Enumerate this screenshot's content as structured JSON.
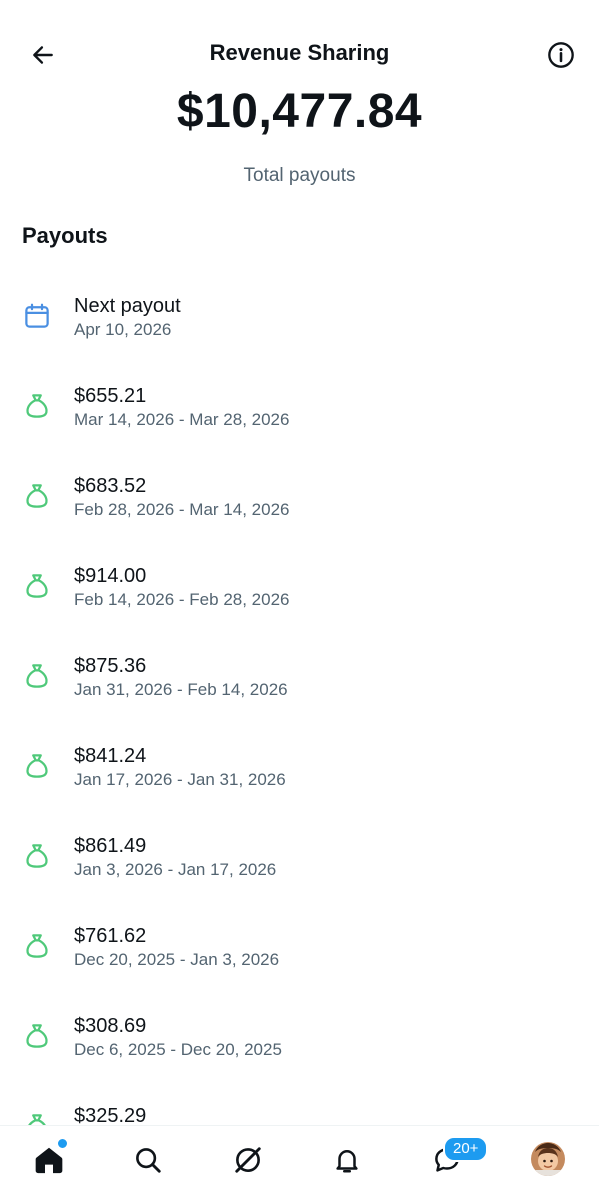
{
  "header": {
    "title": "Revenue Sharing",
    "back_icon": "arrow-left-icon",
    "info_icon": "info-icon"
  },
  "summary": {
    "total": "$10,477.84",
    "label": "Total payouts"
  },
  "section": {
    "title": "Payouts"
  },
  "payouts": [
    {
      "title": "Next payout",
      "subtitle": "Apr 10, 2026",
      "icon": "calendar-icon"
    },
    {
      "title": "$655.21",
      "subtitle": "Mar 14, 2026 - Mar 28, 2026",
      "icon": "money-bag-icon"
    },
    {
      "title": "$683.52",
      "subtitle": "Feb 28, 2026 - Mar 14, 2026",
      "icon": "money-bag-icon"
    },
    {
      "title": "$914.00",
      "subtitle": "Feb 14, 2026 - Feb 28, 2026",
      "icon": "money-bag-icon"
    },
    {
      "title": "$875.36",
      "subtitle": "Jan 31, 2026 - Feb 14, 2026",
      "icon": "money-bag-icon"
    },
    {
      "title": "$841.24",
      "subtitle": "Jan 17, 2026 - Jan 31, 2026",
      "icon": "money-bag-icon"
    },
    {
      "title": "$861.49",
      "subtitle": "Jan 3, 2026 - Jan 17, 2026",
      "icon": "money-bag-icon"
    },
    {
      "title": "$761.62",
      "subtitle": "Dec 20, 2025 - Jan 3, 2026",
      "icon": "money-bag-icon"
    },
    {
      "title": "$308.69",
      "subtitle": "Dec 6, 2025 - Dec 20, 2025",
      "icon": "money-bag-icon"
    },
    {
      "title": "$325.29",
      "subtitle": "",
      "icon": "money-bag-icon"
    }
  ],
  "tabbar": {
    "messages_badge": "20+",
    "tabs": [
      "home-icon",
      "search-icon",
      "grok-icon",
      "bell-icon",
      "messages-icon",
      "avatar"
    ]
  },
  "colors": {
    "accent": "#1d9bf0",
    "money_icon": "#4fc97a",
    "calendar_icon": "#4a8fe2",
    "secondary_text": "#536471"
  }
}
